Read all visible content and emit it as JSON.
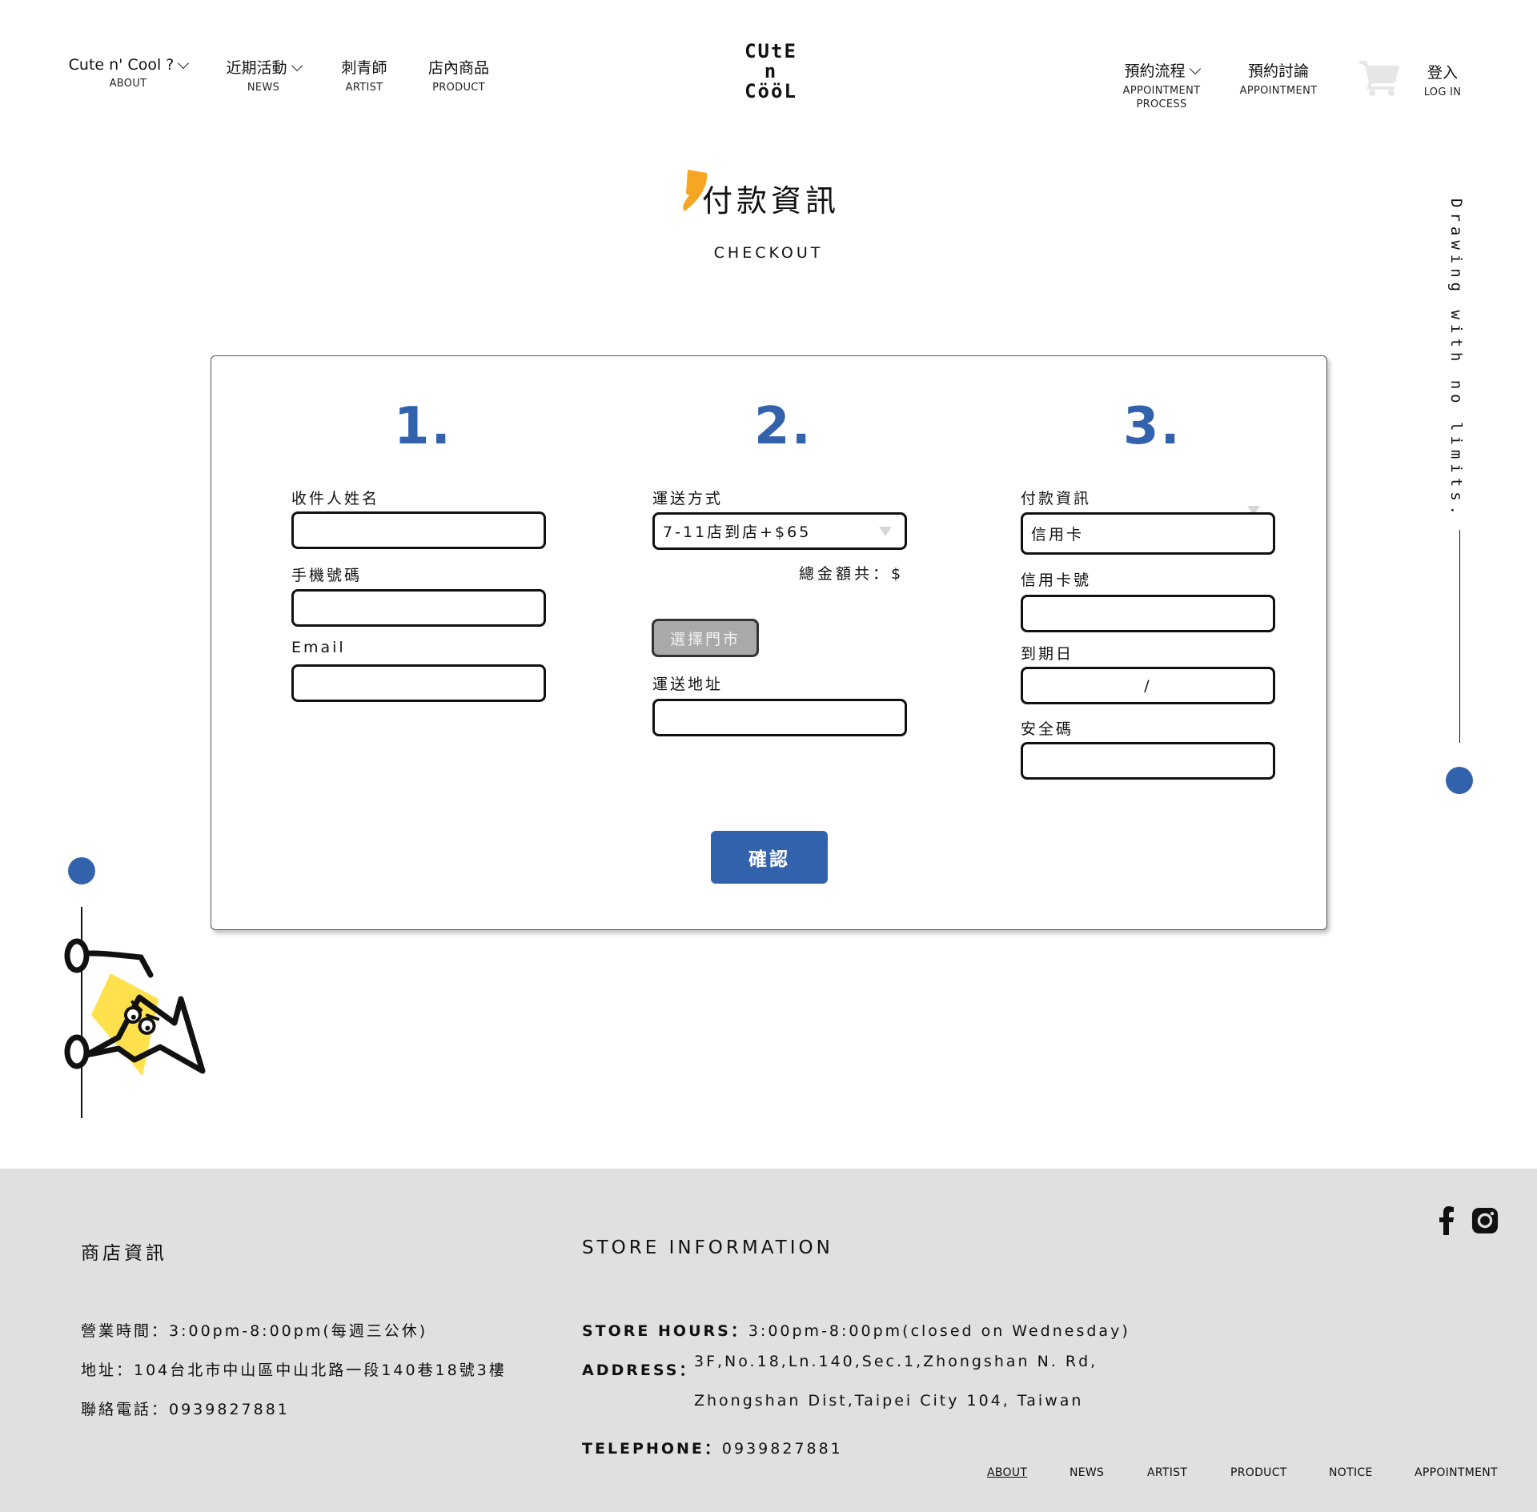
{
  "header": {
    "nav_left": [
      {
        "zh": "Cute n' Cool ?",
        "en": "ABOUT"
      },
      {
        "zh": "近期活動",
        "en": "NEWS"
      },
      {
        "zh": "刺青師",
        "en": "ARTIST"
      },
      {
        "zh": "店內商品",
        "en": "PRODUCT"
      }
    ],
    "logo_lines": [
      "CUtE",
      "n",
      "CööL"
    ],
    "nav_right": [
      {
        "zh": "預約流程",
        "en": "APPOINTMENT PROCESS"
      },
      {
        "zh": "預約討論",
        "en": "APPOINTMENT"
      }
    ],
    "cart_icon": "cart-icon",
    "login": {
      "zh": "登入",
      "en": "LOG IN"
    }
  },
  "page": {
    "title_zh": "付款資訊",
    "title_en": "CHECKOUT",
    "vertical_text": "Drawing with no limits."
  },
  "form": {
    "step1": {
      "number": "1.",
      "name_label": "收件人姓名",
      "phone_label": "手機號碼",
      "email_label": "Email",
      "name_value": "",
      "phone_value": "",
      "email_value": ""
    },
    "step2": {
      "number": "2.",
      "shipping_label": "運送方式",
      "shipping_selected": "7-11店到店+$65",
      "total_label": "總金額共：$",
      "store_button": "選擇門市",
      "address_label": "運送地址",
      "address_value": ""
    },
    "step3": {
      "number": "3.",
      "payment_label": "付款資訊",
      "payment_selected": "信用卡",
      "card_label": "信用卡號",
      "card_value": "",
      "expiry_label": "到期日",
      "expiry_separator": "/",
      "cvv_label": "安全碼",
      "cvv_value": ""
    },
    "confirm_button": "確認"
  },
  "footer": {
    "zh": {
      "heading": "商店資訊",
      "hours": "營業時間：3:00pm-8:00pm(每週三公休)",
      "address": "地址：104台北市中山區中山北路一段140巷18號3樓",
      "phone": "聯絡電話：0939827881"
    },
    "en": {
      "heading": "STORE INFORMATION",
      "hours_label": "STORE HOURS：",
      "hours_value": "3:00pm-8:00pm(closed on Wednesday)",
      "address_label": "ADDRESS：",
      "address_line1": "3F,No.18,Ln.140,Sec.1,Zhongshan N. Rd,",
      "address_line2": "Zhongshan Dist,Taipei City 104, Taiwan",
      "phone_label": "TELEPHONE：",
      "phone_value": "0939827881"
    },
    "social_icons": [
      "facebook-icon",
      "instagram-icon"
    ],
    "nav": [
      "ABOUT",
      "NEWS",
      "ARTIST",
      "PRODUCT",
      "NOTICE",
      "APPOINTMENT"
    ]
  },
  "colors": {
    "accent_blue": "#3362ad",
    "footer_bg": "#e0e0e0",
    "title_mark": "#f5a623",
    "mascot_yellow": "#ffe14d"
  }
}
